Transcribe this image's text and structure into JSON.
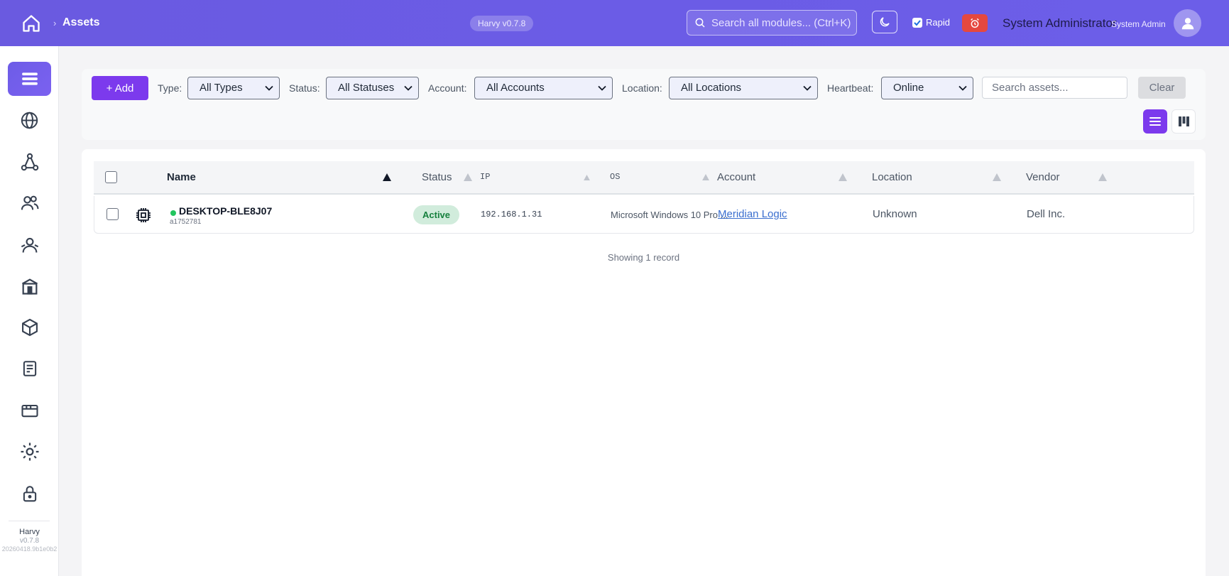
{
  "header": {
    "breadcrumb": "Assets",
    "version_pill": "Harvy v0.7.8",
    "search_placeholder": "Search all modules... (Ctrl+K)",
    "rapid_label": "Rapid",
    "rapid_checked": true,
    "user_name": "System Administrator",
    "user_role": "System Admin"
  },
  "sidebar": {
    "items": [
      {
        "icon": "menu-icon",
        "active": true
      },
      {
        "icon": "globe-icon",
        "active": false
      },
      {
        "icon": "network-icon",
        "active": false
      },
      {
        "icon": "users-icon",
        "active": false
      },
      {
        "icon": "contact-icon",
        "active": false
      },
      {
        "icon": "building-icon",
        "active": false
      },
      {
        "icon": "cube-icon",
        "active": false
      },
      {
        "icon": "document-icon",
        "active": false
      },
      {
        "icon": "ticket-icon",
        "active": false
      },
      {
        "icon": "settings-icon",
        "active": false
      },
      {
        "icon": "lock-icon",
        "active": false
      }
    ],
    "footer": {
      "app": "Harvy",
      "version": "v0.7.8",
      "build": "20260418.9b1e0b2"
    }
  },
  "filters": {
    "add_label": "+ Add",
    "type_label": "Type:",
    "type_value": "All Types",
    "status_label": "Status:",
    "status_value": "All Statuses",
    "account_label": "Account:",
    "account_value": "All Accounts",
    "location_label": "Location:",
    "location_value": "All Locations",
    "heartbeat_label": "Heartbeat:",
    "heartbeat_value": "Online",
    "search_placeholder": "Search assets...",
    "clear_label": "Clear"
  },
  "table": {
    "columns": {
      "name": "Name",
      "status": "Status",
      "ip": "IP",
      "os": "OS",
      "account": "Account",
      "location": "Location",
      "vendor": "Vendor"
    },
    "rows": [
      {
        "name": "DESKTOP-BLE8J07",
        "sub": "a1752781",
        "status": "Active",
        "ip": "192.168.1.31",
        "os": "Microsoft Windows 10 Pro ...",
        "account": "Meridian Logic",
        "location": "Unknown",
        "vendor": "Dell Inc."
      }
    ],
    "footer": "Showing 1 record"
  },
  "colors": {
    "accent": "#7c3aed",
    "header": "#6b5ce6",
    "status_ok": "#22c55e",
    "alert": "#e5483f"
  }
}
